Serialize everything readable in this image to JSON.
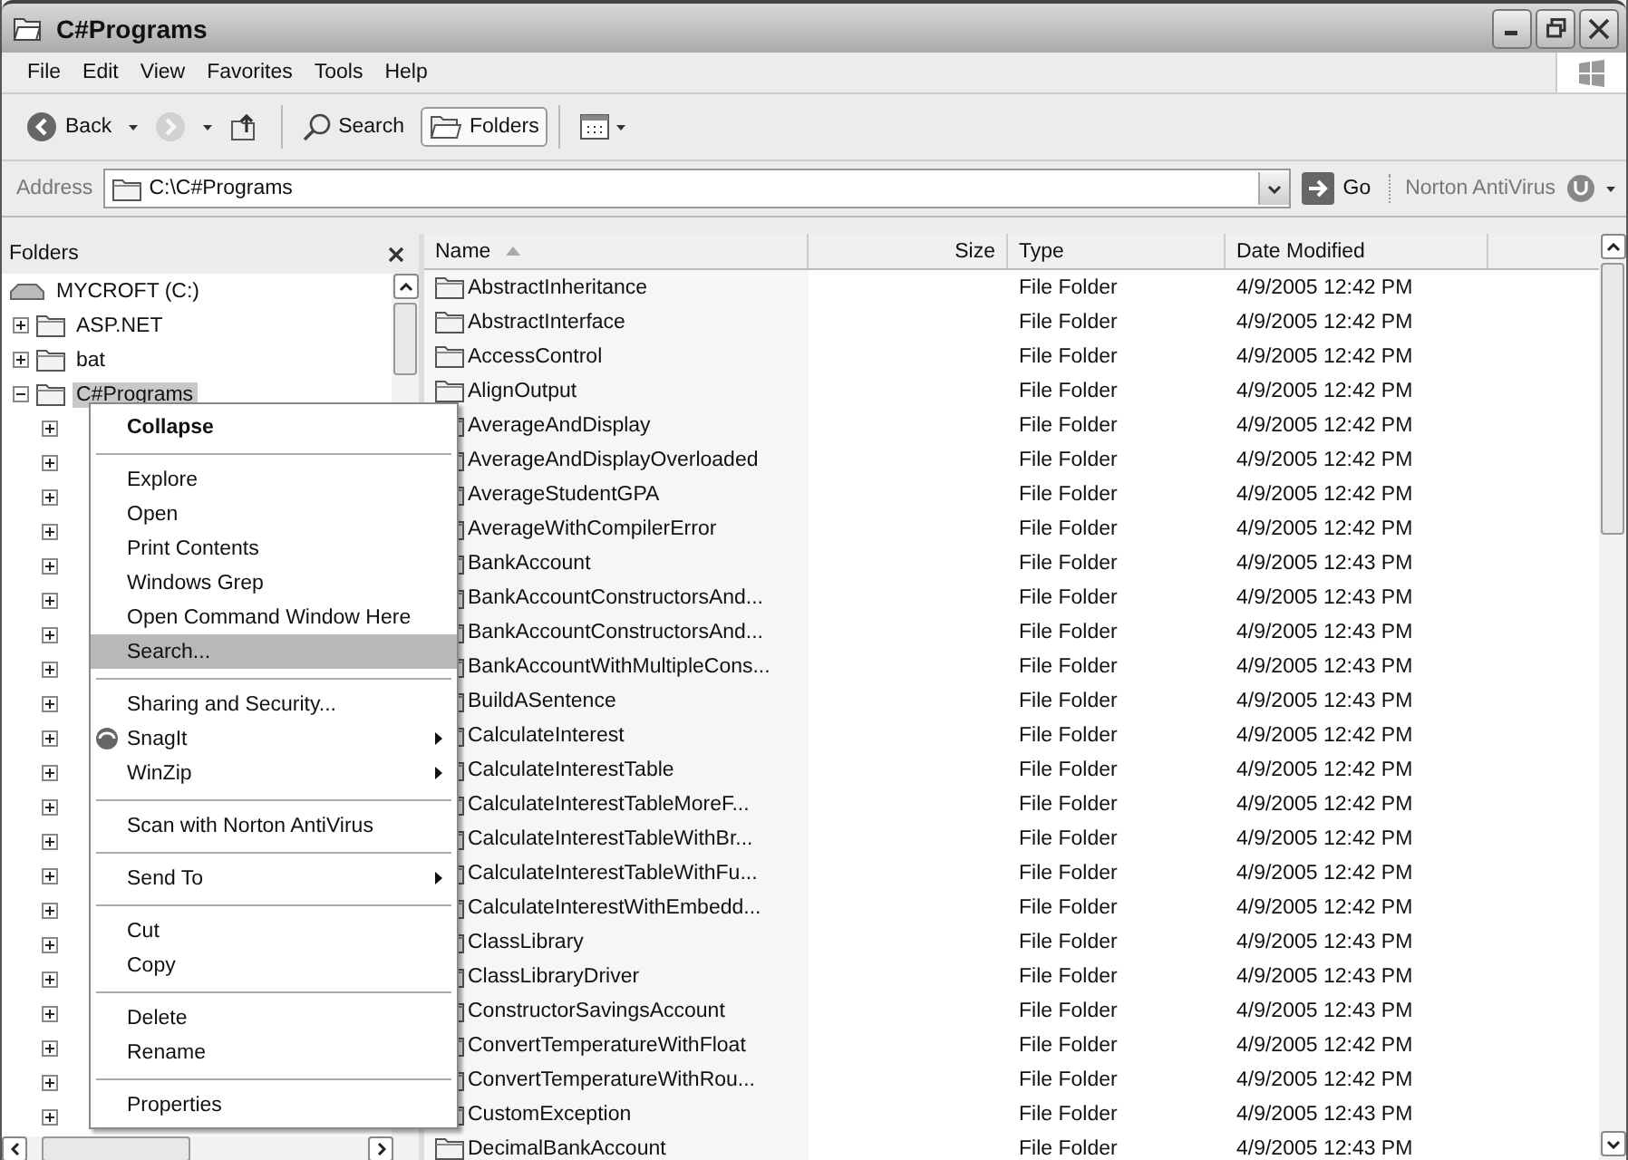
{
  "window": {
    "title": "C#Programs"
  },
  "menu_bar": [
    "File",
    "Edit",
    "View",
    "Favorites",
    "Tools",
    "Help"
  ],
  "toolbar": [
    {
      "kind": "back",
      "label": "Back",
      "disabled": false,
      "selected": false
    },
    {
      "kind": "forward",
      "disabled": true,
      "selected": false
    },
    {
      "kind": "up",
      "disabled": false,
      "selected": false
    },
    {
      "kind": "search",
      "label": "Search",
      "disabled": false,
      "selected": false
    },
    {
      "kind": "folders",
      "label": "Folders",
      "disabled": false,
      "selected": true
    },
    {
      "kind": "views",
      "disabled": false,
      "selected": false
    }
  ],
  "address_bar": {
    "label": "Address",
    "value": "C:\\C#Programs",
    "go": "Go",
    "norton": "Norton AntiVirus"
  },
  "folders_pane": {
    "title": "Folders",
    "tree": {
      "label": "MYCROFT (C:)",
      "children": [
        {
          "label": "ASP.NET",
          "expanded": false,
          "selected": false
        },
        {
          "label": "bat",
          "expanded": false,
          "selected": false
        },
        {
          "label": "C#Programs",
          "expanded": true,
          "selected": true,
          "children": [
            {
              "expanded": false
            },
            {
              "expanded": false
            },
            {
              "expanded": false
            },
            {
              "expanded": false
            },
            {
              "expanded": false
            },
            {
              "expanded": false
            },
            {
              "expanded": false
            },
            {
              "expanded": false
            },
            {
              "expanded": false
            },
            {
              "expanded": false
            },
            {
              "expanded": false
            },
            {
              "expanded": false
            },
            {
              "expanded": false
            },
            {
              "expanded": false
            },
            {
              "expanded": false
            },
            {
              "expanded": false
            },
            {
              "expanded": false
            },
            {
              "expanded": false
            },
            {
              "expanded": false
            },
            {
              "expanded": false
            },
            {
              "expanded": false
            }
          ]
        }
      ]
    }
  },
  "file_list": {
    "columns": [
      {
        "label": "Name",
        "sorted": true
      },
      {
        "label": "Size",
        "sorted": false
      },
      {
        "label": "Type",
        "sorted": false
      },
      {
        "label": "Date Modified",
        "sorted": false
      }
    ],
    "rows": [
      {
        "name": "AbstractInheritance",
        "type": "File Folder",
        "date": "4/9/2005 12:42 PM"
      },
      {
        "name": "AbstractInterface",
        "type": "File Folder",
        "date": "4/9/2005 12:42 PM"
      },
      {
        "name": "AccessControl",
        "type": "File Folder",
        "date": "4/9/2005 12:42 PM"
      },
      {
        "name": "AlignOutput",
        "type": "File Folder",
        "date": "4/9/2005 12:42 PM"
      },
      {
        "name": "AverageAndDisplay",
        "type": "File Folder",
        "date": "4/9/2005 12:42 PM"
      },
      {
        "name": "AverageAndDisplayOverloaded",
        "type": "File Folder",
        "date": "4/9/2005 12:42 PM"
      },
      {
        "name": "AverageStudentGPA",
        "type": "File Folder",
        "date": "4/9/2005 12:42 PM"
      },
      {
        "name": "AverageWithCompilerError",
        "type": "File Folder",
        "date": "4/9/2005 12:42 PM"
      },
      {
        "name": "BankAccount",
        "type": "File Folder",
        "date": "4/9/2005 12:43 PM"
      },
      {
        "name": "BankAccountConstructorsAnd...",
        "type": "File Folder",
        "date": "4/9/2005 12:43 PM"
      },
      {
        "name": "BankAccountConstructorsAnd...",
        "type": "File Folder",
        "date": "4/9/2005 12:43 PM"
      },
      {
        "name": "BankAccountWithMultipleCons...",
        "type": "File Folder",
        "date": "4/9/2005 12:43 PM"
      },
      {
        "name": "BuildASentence",
        "type": "File Folder",
        "date": "4/9/2005 12:43 PM"
      },
      {
        "name": "CalculateInterest",
        "type": "File Folder",
        "date": "4/9/2005 12:42 PM"
      },
      {
        "name": "CalculateInterestTable",
        "type": "File Folder",
        "date": "4/9/2005 12:42 PM"
      },
      {
        "name": "CalculateInterestTableMoreF...",
        "type": "File Folder",
        "date": "4/9/2005 12:42 PM"
      },
      {
        "name": "CalculateInterestTableWithBr...",
        "type": "File Folder",
        "date": "4/9/2005 12:42 PM"
      },
      {
        "name": "CalculateInterestTableWithFu...",
        "type": "File Folder",
        "date": "4/9/2005 12:42 PM"
      },
      {
        "name": "CalculateInterestWithEmbedd...",
        "type": "File Folder",
        "date": "4/9/2005 12:42 PM"
      },
      {
        "name": "ClassLibrary",
        "type": "File Folder",
        "date": "4/9/2005 12:43 PM"
      },
      {
        "name": "ClassLibraryDriver",
        "type": "File Folder",
        "date": "4/9/2005 12:43 PM"
      },
      {
        "name": "ConstructorSavingsAccount",
        "type": "File Folder",
        "date": "4/9/2005 12:43 PM"
      },
      {
        "name": "ConvertTemperatureWithFloat",
        "type": "File Folder",
        "date": "4/9/2005 12:42 PM"
      },
      {
        "name": "ConvertTemperatureWithRou...",
        "type": "File Folder",
        "date": "4/9/2005 12:42 PM"
      },
      {
        "name": "CustomException",
        "type": "File Folder",
        "date": "4/9/2005 12:43 PM"
      },
      {
        "name": "DecimalBankAccount",
        "type": "File Folder",
        "date": "4/9/2005 12:43 PM"
      }
    ]
  },
  "context_menu": [
    {
      "kind": "item",
      "label": "Collapse",
      "default": true,
      "submenu": false,
      "selected": false
    },
    {
      "kind": "separator"
    },
    {
      "kind": "item",
      "label": "Explore",
      "default": false,
      "submenu": false,
      "selected": false
    },
    {
      "kind": "item",
      "label": "Open",
      "default": false,
      "submenu": false,
      "selected": false
    },
    {
      "kind": "item",
      "label": "Print Contents",
      "default": false,
      "submenu": false,
      "selected": false
    },
    {
      "kind": "item",
      "label": "Windows Grep",
      "default": false,
      "submenu": false,
      "selected": false
    },
    {
      "kind": "item",
      "label": "Open Command Window Here",
      "default": false,
      "submenu": false,
      "selected": false
    },
    {
      "kind": "item",
      "label": "Search...",
      "default": false,
      "submenu": false,
      "selected": true
    },
    {
      "kind": "separator"
    },
    {
      "kind": "item",
      "label": "Sharing and Security...",
      "default": false,
      "submenu": false,
      "selected": false
    },
    {
      "kind": "icon_item",
      "label": "SnagIt",
      "default": false,
      "submenu": true,
      "selected": false
    },
    {
      "kind": "item",
      "label": "WinZip",
      "default": false,
      "submenu": true,
      "selected": false
    },
    {
      "kind": "separator"
    },
    {
      "kind": "item",
      "label": "Scan with Norton AntiVirus",
      "default": false,
      "submenu": false,
      "selected": false
    },
    {
      "kind": "separator"
    },
    {
      "kind": "item",
      "label": "Send To",
      "default": false,
      "submenu": true,
      "selected": false
    },
    {
      "kind": "separator"
    },
    {
      "kind": "item",
      "label": "Cut",
      "default": false,
      "submenu": false,
      "selected": false
    },
    {
      "kind": "item",
      "label": "Copy",
      "default": false,
      "submenu": false,
      "selected": false
    },
    {
      "kind": "separator"
    },
    {
      "kind": "item",
      "label": "Delete",
      "default": false,
      "submenu": false,
      "selected": false
    },
    {
      "kind": "item",
      "label": "Rename",
      "default": false,
      "submenu": false,
      "selected": false
    },
    {
      "kind": "separator"
    },
    {
      "kind": "item",
      "label": "Properties",
      "default": false,
      "submenu": false,
      "selected": false
    }
  ]
}
